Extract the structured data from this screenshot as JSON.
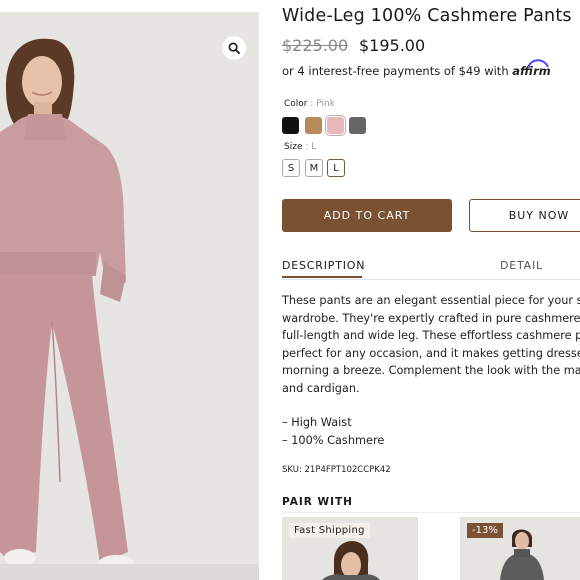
{
  "product": {
    "title": "Wide-Leg 100% Cashmere Pants",
    "price_original": "$225.00",
    "price_sale": "$195.00",
    "installments_text": "or 4 interest-free payments of $49 with",
    "affirm_brand": "affirm"
  },
  "options": {
    "color_label": "Color",
    "color_separator": ":",
    "color_value": "Pink",
    "swatches": [
      {
        "name": "black",
        "hex": "#111111"
      },
      {
        "name": "camel",
        "hex": "#b88a58"
      },
      {
        "name": "pink",
        "hex": "#e7b9bd"
      },
      {
        "name": "gray",
        "hex": "#666666"
      }
    ],
    "selected_color": "pink",
    "size_label": "Size",
    "size_separator": ":",
    "size_value": "L",
    "sizes": [
      "S",
      "M",
      "L"
    ],
    "selected_size": "L"
  },
  "actions": {
    "add_to_cart": "ADD TO CART",
    "buy_now": "BUY NOW"
  },
  "tabs": [
    {
      "label": "DESCRIPTION",
      "active": true
    },
    {
      "label": "DETAIL",
      "active": false
    }
  ],
  "description": {
    "lines": [
      "These pants are an elegant essential piece for your seas",
      "wardrobe. They're expertly crafted in pure cashmere yar",
      "full-length and wide leg. These effortless cashmere pant",
      "perfect for any occasion, and it makes getting dressed in",
      "morning a breeze. Complement the look with the matchi",
      "and cardigan."
    ],
    "bullets": [
      "– High Waist",
      "– 100% Cashmere"
    ],
    "sku": "SKU: 21P4FPT102CCPK42"
  },
  "pair_with": {
    "title": "PAIR WITH",
    "cards": [
      {
        "badge": "Fast Shipping"
      },
      {
        "badge": "-13%"
      }
    ]
  },
  "colors": {
    "accent": "#7a5233",
    "garment": "#c99ca0"
  }
}
